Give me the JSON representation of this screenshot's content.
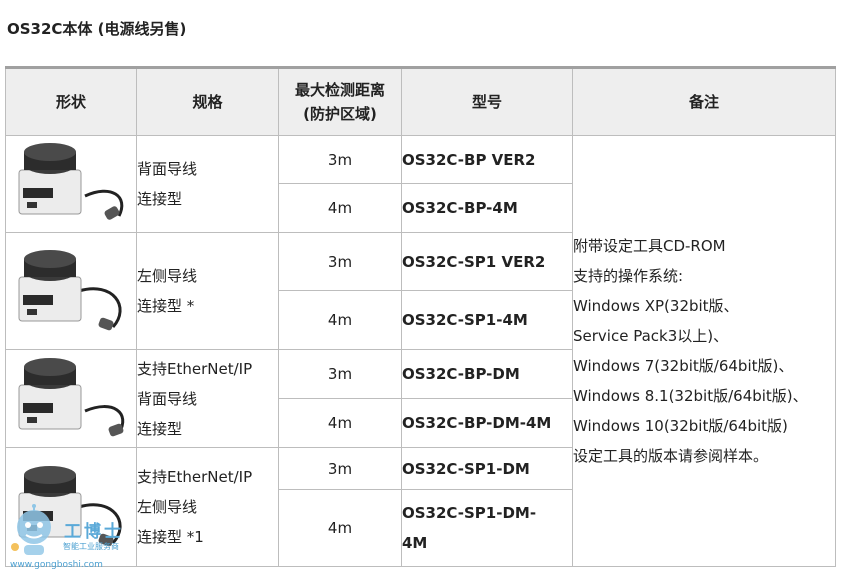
{
  "page_title": "OS32C本体 (电源线另售)",
  "headers": {
    "shape": "形状",
    "spec": "规格",
    "range_line1": "最大检测距离",
    "range_line2": "(防护区域)",
    "model": "型号",
    "note": "备注"
  },
  "groups": [
    {
      "spec_lines": [
        "背面导线",
        "连接型"
      ],
      "rows": [
        {
          "range": "3m",
          "model": "OS32C-BP VER2"
        },
        {
          "range": "4m",
          "model": "OS32C-BP-4M"
        }
      ]
    },
    {
      "spec_lines": [
        "左侧导线",
        "连接型 *"
      ],
      "rows": [
        {
          "range": "3m",
          "model": "OS32C-SP1 VER2"
        },
        {
          "range": "4m",
          "model": "OS32C-SP1-4M"
        }
      ]
    },
    {
      "spec_lines": [
        "支持EtherNet/IP",
        "背面导线",
        "连接型"
      ],
      "rows": [
        {
          "range": "3m",
          "model": "OS32C-BP-DM"
        },
        {
          "range": "4m",
          "model": "OS32C-BP-DM-4M"
        }
      ]
    },
    {
      "spec_lines": [
        "支持EtherNet/IP",
        "左侧导线",
        "连接型 *1"
      ],
      "rows": [
        {
          "range": "3m",
          "model": "OS32C-SP1-DM"
        },
        {
          "range": "4m",
          "model_line1": "OS32C-SP1-DM-",
          "model_line2": "4M"
        }
      ]
    }
  ],
  "note_lines": [
    "附带设定工具CD-ROM",
    "支持的操作系统:",
    "Windows XP(32bit版、",
    "Service Pack3以上)、",
    "Windows 7(32bit版/64bit版)、",
    "Windows 8.1(32bit版/64bit版)、",
    "Windows 10(32bit版/64bit版)",
    "设定工具的版本请参阅样本。"
  ],
  "watermark": {
    "brand": "工博士",
    "tagline": "智能工业服务商",
    "url": "www.gongboshi.com"
  },
  "icons": {
    "product": "os32c-laser-scanner-image",
    "mascot": "robot-mascot-icon"
  },
  "colors": {
    "header_bg": "#eeeeee",
    "border": "#bdbdbd",
    "top_rule": "#a0a0a0",
    "watermark": "#5aa9d8"
  }
}
